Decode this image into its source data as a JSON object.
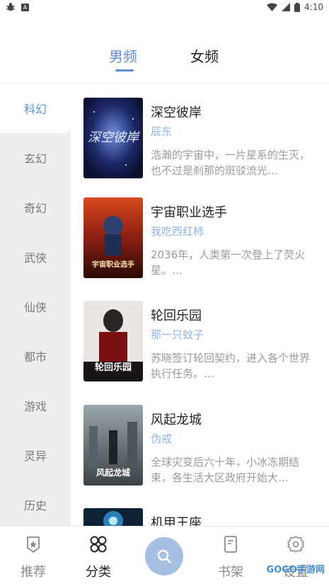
{
  "status_bar": {
    "time": "4:10"
  },
  "gender_tabs": [
    {
      "label": "男频",
      "active": true
    },
    {
      "label": "女频",
      "active": false
    }
  ],
  "categories": [
    "科幻",
    "玄幻",
    "奇幻",
    "武侠",
    "仙侠",
    "都市",
    "游戏",
    "灵异",
    "历史"
  ],
  "active_category": "科幻",
  "books": [
    {
      "title": "深空彼岸",
      "author": "辰东",
      "desc": "浩瀚的宇宙中，一片星系的生灭，也不过是刹那的斑驳流光…",
      "cover_text": "深空彼岸"
    },
    {
      "title": "宇宙职业选手",
      "author": "我吃西红柿",
      "desc": "2036年，人类第一次登上了荧火星。…",
      "cover_text": "宇宙职业选手"
    },
    {
      "title": "轮回乐园",
      "author": "那一只蚊子",
      "desc": "苏晓签订轮回契约，进入各个世界执行任务。…",
      "cover_text": "轮回乐园"
    },
    {
      "title": "风起龙城",
      "author": "伪戒",
      "desc": "全球灾变后六十年，小冰冻期结束，各生活大区政府开始大…",
      "cover_text": "风起龙城"
    },
    {
      "title": "机甲王座",
      "author": "",
      "desc": "",
      "cover_text": ""
    }
  ],
  "bottom_nav": [
    {
      "label": "推荐",
      "icon": "recommend-icon",
      "active": false
    },
    {
      "label": "分类",
      "icon": "category-icon",
      "active": true
    },
    {
      "label": "",
      "icon": "search-icon",
      "active": false
    },
    {
      "label": "书架",
      "icon": "bookshelf-icon",
      "active": false
    },
    {
      "label": "设置",
      "icon": "settings-icon",
      "active": false
    }
  ],
  "watermark": "GOGO手游网",
  "colors": {
    "accent": "#5b8ed6",
    "author": "#8fb3e0",
    "sidebar_bg": "#eeeeee",
    "search_button": "#a6c0e3"
  }
}
